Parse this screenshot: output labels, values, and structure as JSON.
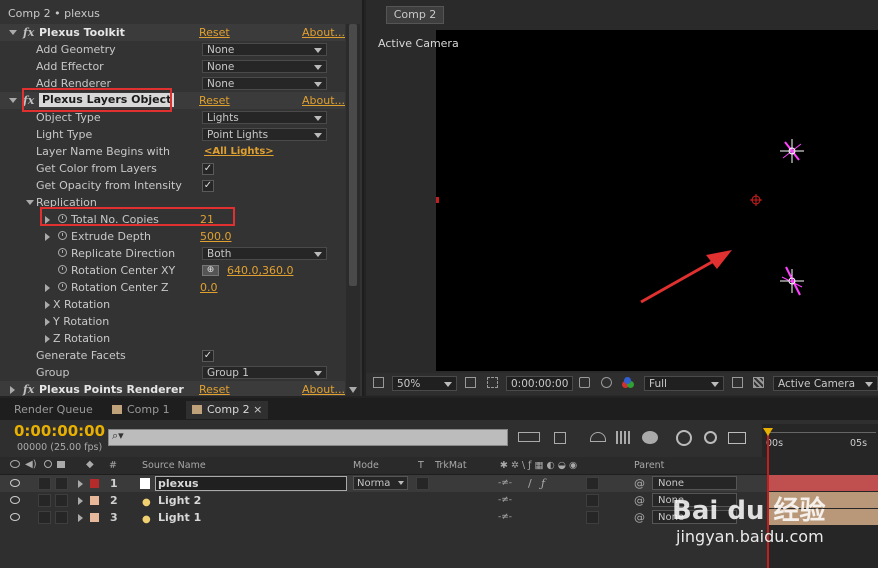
{
  "effects_panel": {
    "title": "Comp 2 • plexus",
    "rows": [
      {
        "label": "Plexus Toolkit",
        "reset": "Reset",
        "about": "About..."
      },
      {
        "label": "Add Geometry",
        "value": "None"
      },
      {
        "label": "Add Effector",
        "value": "None"
      },
      {
        "label": "Add Renderer",
        "value": "None"
      },
      {
        "label": "Plexus Layers Object",
        "reset": "Reset",
        "about": "About..."
      },
      {
        "label": "Object Type",
        "value": "Lights"
      },
      {
        "label": "Light Type",
        "value": "Point Lights"
      },
      {
        "label": "Layer Name Begins with",
        "value": "<All Lights>"
      },
      {
        "label": "Get Color from Layers",
        "checked": "✓"
      },
      {
        "label": "Get Opacity from Intensity",
        "checked": "✓"
      },
      {
        "label": "Replication"
      },
      {
        "label": "Total No. Copies",
        "value": "21"
      },
      {
        "label": "Extrude Depth",
        "value": "500.0"
      },
      {
        "label": "Replicate Direction",
        "value": "Both"
      },
      {
        "label": "Rotation Center XY",
        "value": "640.0,360.0"
      },
      {
        "label": "Rotation Center Z",
        "value": "0.0"
      },
      {
        "label": "X Rotation"
      },
      {
        "label": "Y Rotation"
      },
      {
        "label": "Z Rotation"
      },
      {
        "label": "Generate Facets",
        "checked": "✓"
      },
      {
        "label": "Group",
        "value": "Group 1"
      },
      {
        "label": "Plexus Points Renderer",
        "reset": "Reset",
        "about": "About..."
      }
    ],
    "fx_symbol": "fx"
  },
  "composition": {
    "tab": "Comp 2",
    "camera_label": "Active Camera",
    "toolbar": {
      "zoom": "50%",
      "timecode": "0:00:00:00",
      "resolution": "Full",
      "view": "Active Camera"
    }
  },
  "timeline": {
    "tabs": [
      "Render Queue",
      "Comp 1",
      "Comp 2"
    ],
    "close_glyph": "×",
    "search_glyph": "⌕▾",
    "timecode": "0:00:00:00",
    "fps": "00000 (25.00 fps)",
    "ruler": [
      "00s",
      "05s"
    ],
    "headers": {
      "number": "#",
      "source_name": "Source Name",
      "mode": "Mode",
      "t": "T",
      "trkmat": "TrkMat",
      "parent": "Parent"
    },
    "layers": [
      {
        "num": "1",
        "name": "plexus",
        "mode": "Norma",
        "parent": "None",
        "color": "#b52a2a"
      },
      {
        "num": "2",
        "name": "Light 2",
        "parent": "None",
        "color": "#e8b89a"
      },
      {
        "num": "3",
        "name": "Light 1",
        "parent": "None",
        "color": "#e8b89a"
      }
    ]
  },
  "watermark": {
    "text": "Bai du 经验",
    "url": "jingyan.baidu.com"
  },
  "colors": {
    "accent_link": "#e0a030",
    "timecode": "#e8b000",
    "highlight_box": "#e03030",
    "arrow": "#e03030"
  }
}
